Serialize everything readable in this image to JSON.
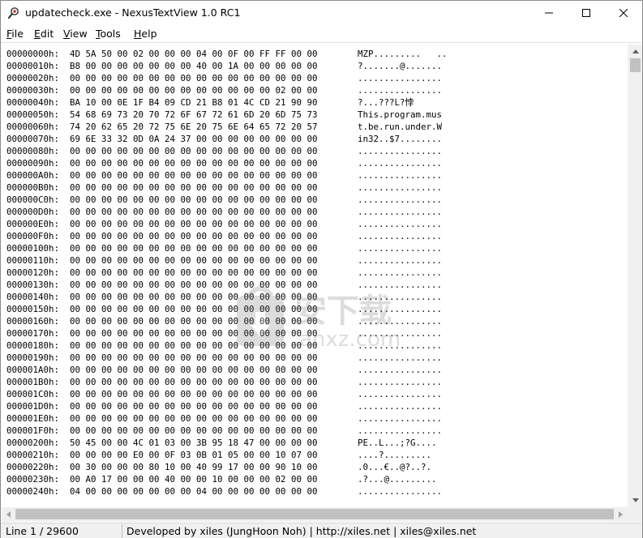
{
  "window": {
    "title": "updatecheck.exe - NexusTextView 1.0 RC1",
    "app_icon": "magnifier-app-icon",
    "controls": {
      "minimize": "minimize-icon",
      "maximize": "maximize-icon",
      "close": "close-icon"
    }
  },
  "menu": {
    "items": [
      {
        "label": "File",
        "mnemonic": "F",
        "rest": "ile"
      },
      {
        "label": "Edit",
        "mnemonic": "E",
        "rest": "dit"
      },
      {
        "label": "View",
        "mnemonic": "V",
        "rest": "iew"
      },
      {
        "label": "Tools",
        "mnemonic": "T",
        "rest": "ools"
      },
      {
        "label": "Help",
        "mnemonic": "H",
        "rest": "elp"
      }
    ]
  },
  "hex_view": {
    "lines": [
      {
        "addr": "00000000h:",
        "bytes": "4D 5A 50 00 02 00 00 00 04 00 0F 00 FF FF 00 00",
        "ascii": "MZP.........   .."
      },
      {
        "addr": "00000010h:",
        "bytes": "B8 00 00 00 00 00 00 00 40 00 1A 00 00 00 00 00",
        "ascii": "?.......@......."
      },
      {
        "addr": "00000020h:",
        "bytes": "00 00 00 00 00 00 00 00 00 00 00 00 00 00 00 00",
        "ascii": "................"
      },
      {
        "addr": "00000030h:",
        "bytes": "00 00 00 00 00 00 00 00 00 00 00 00 00 02 00 00",
        "ascii": "................"
      },
      {
        "addr": "00000040h:",
        "bytes": "BA 10 00 0E 1F B4 09 CD 21 B8 01 4C CD 21 90 90",
        "ascii": "?...???L?悖"
      },
      {
        "addr": "00000050h:",
        "bytes": "54 68 69 73 20 70 72 6F 67 72 61 6D 20 6D 75 73",
        "ascii": "This.program.mus"
      },
      {
        "addr": "00000060h:",
        "bytes": "74 20 62 65 20 72 75 6E 20 75 6E 64 65 72 20 57",
        "ascii": "t.be.run.under.W"
      },
      {
        "addr": "00000070h:",
        "bytes": "69 6E 33 32 0D 0A 24 37 00 00 00 00 00 00 00 00",
        "ascii": "in32..$7........"
      },
      {
        "addr": "00000080h:",
        "bytes": "00 00 00 00 00 00 00 00 00 00 00 00 00 00 00 00",
        "ascii": "................"
      },
      {
        "addr": "00000090h:",
        "bytes": "00 00 00 00 00 00 00 00 00 00 00 00 00 00 00 00",
        "ascii": "................"
      },
      {
        "addr": "000000A0h:",
        "bytes": "00 00 00 00 00 00 00 00 00 00 00 00 00 00 00 00",
        "ascii": "................"
      },
      {
        "addr": "000000B0h:",
        "bytes": "00 00 00 00 00 00 00 00 00 00 00 00 00 00 00 00",
        "ascii": "................"
      },
      {
        "addr": "000000C0h:",
        "bytes": "00 00 00 00 00 00 00 00 00 00 00 00 00 00 00 00",
        "ascii": "................"
      },
      {
        "addr": "000000D0h:",
        "bytes": "00 00 00 00 00 00 00 00 00 00 00 00 00 00 00 00",
        "ascii": "................"
      },
      {
        "addr": "000000E0h:",
        "bytes": "00 00 00 00 00 00 00 00 00 00 00 00 00 00 00 00",
        "ascii": "................"
      },
      {
        "addr": "000000F0h:",
        "bytes": "00 00 00 00 00 00 00 00 00 00 00 00 00 00 00 00",
        "ascii": "................"
      },
      {
        "addr": "00000100h:",
        "bytes": "00 00 00 00 00 00 00 00 00 00 00 00 00 00 00 00",
        "ascii": "................"
      },
      {
        "addr": "00000110h:",
        "bytes": "00 00 00 00 00 00 00 00 00 00 00 00 00 00 00 00",
        "ascii": "................"
      },
      {
        "addr": "00000120h:",
        "bytes": "00 00 00 00 00 00 00 00 00 00 00 00 00 00 00 00",
        "ascii": "................"
      },
      {
        "addr": "00000130h:",
        "bytes": "00 00 00 00 00 00 00 00 00 00 00 00 00 00 00 00",
        "ascii": "................"
      },
      {
        "addr": "00000140h:",
        "bytes": "00 00 00 00 00 00 00 00 00 00 00 00 00 00 00 00",
        "ascii": "................"
      },
      {
        "addr": "00000150h:",
        "bytes": "00 00 00 00 00 00 00 00 00 00 00 00 00 00 00 00",
        "ascii": "................"
      },
      {
        "addr": "00000160h:",
        "bytes": "00 00 00 00 00 00 00 00 00 00 00 00 00 00 00 00",
        "ascii": "................"
      },
      {
        "addr": "00000170h:",
        "bytes": "00 00 00 00 00 00 00 00 00 00 00 00 00 00 00 00",
        "ascii": "................"
      },
      {
        "addr": "00000180h:",
        "bytes": "00 00 00 00 00 00 00 00 00 00 00 00 00 00 00 00",
        "ascii": "................"
      },
      {
        "addr": "00000190h:",
        "bytes": "00 00 00 00 00 00 00 00 00 00 00 00 00 00 00 00",
        "ascii": "................"
      },
      {
        "addr": "000001A0h:",
        "bytes": "00 00 00 00 00 00 00 00 00 00 00 00 00 00 00 00",
        "ascii": "................"
      },
      {
        "addr": "000001B0h:",
        "bytes": "00 00 00 00 00 00 00 00 00 00 00 00 00 00 00 00",
        "ascii": "................"
      },
      {
        "addr": "000001C0h:",
        "bytes": "00 00 00 00 00 00 00 00 00 00 00 00 00 00 00 00",
        "ascii": "................"
      },
      {
        "addr": "000001D0h:",
        "bytes": "00 00 00 00 00 00 00 00 00 00 00 00 00 00 00 00",
        "ascii": "................"
      },
      {
        "addr": "000001E0h:",
        "bytes": "00 00 00 00 00 00 00 00 00 00 00 00 00 00 00 00",
        "ascii": "................"
      },
      {
        "addr": "000001F0h:",
        "bytes": "00 00 00 00 00 00 00 00 00 00 00 00 00 00 00 00",
        "ascii": "................"
      },
      {
        "addr": "00000200h:",
        "bytes": "50 45 00 00 4C 01 03 00 3B 95 18 47 00 00 00 00",
        "ascii": "PE..L...;?G...."
      },
      {
        "addr": "00000210h:",
        "bytes": "00 00 00 00 E0 00 0F 03 0B 01 05 00 00 10 07 00",
        "ascii": "....?........."
      },
      {
        "addr": "00000220h:",
        "bytes": "00 30 00 00 00 80 10 00 40 99 17 00 00 90 10 00",
        "ascii": ".0...€..@?..?."
      },
      {
        "addr": "00000230h:",
        "bytes": "00 A0 17 00 00 00 40 00 00 10 00 00 00 02 00 00",
        "ascii": ".?...@........."
      },
      {
        "addr": "00000240h:",
        "bytes": "04 00 00 00 00 00 00 00 04 00 00 00 00 00 00 00",
        "ascii": "................"
      }
    ]
  },
  "watermark": {
    "text": "anxz.com",
    "chinese": "安下载"
  },
  "statusbar": {
    "line_info": "Line 1 / 29600",
    "credits": "Developed by xiles (JungHoon Noh)  |  http://xiles.net  |  xiles@xiles.net"
  }
}
